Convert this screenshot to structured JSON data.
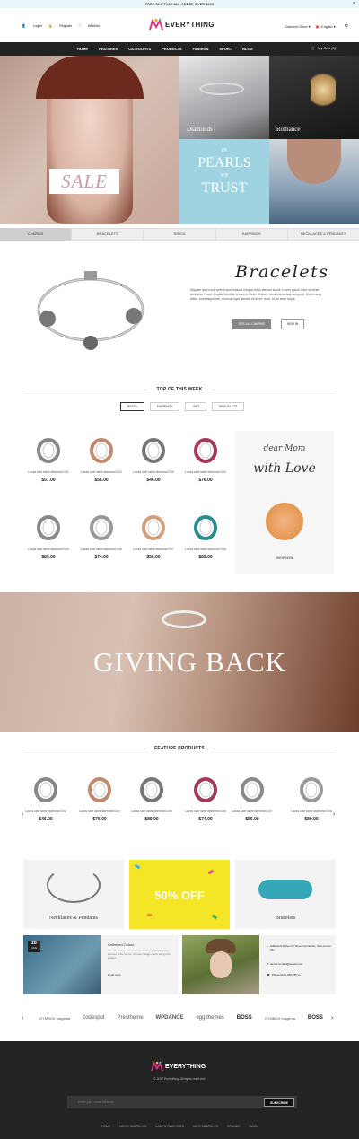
{
  "topbar": {
    "text": "FREE SHIPPING ALL ORDER OVER $399",
    "close": "×"
  },
  "header": {
    "login": "Log In",
    "register": "Register",
    "wishlist": "Wishlist",
    "brand": "EVERYTHING",
    "store": "Diamond Store ▾",
    "language": "English ▾"
  },
  "nav": {
    "items": [
      "HOME",
      "FEATURES",
      "CATEGORYS",
      "PRODUCTS",
      "FASHION",
      "SPORT",
      "BLOG"
    ],
    "cart": "My Cart (0)"
  },
  "hero": {
    "sale": "SALE",
    "diamonds": "Diamonds",
    "romance": "Romance",
    "pearls_line1": "IN",
    "pearls_line2": "PEARLS",
    "pearls_line3": "WE",
    "pearls_line4": "TRUST"
  },
  "tabs": [
    "CHARMS",
    "BRACELETS",
    "RINGS",
    "EARRINGS",
    "NECKLACES & PENDANTS"
  ],
  "feature": {
    "title": "Bracelets",
    "text": "Aliquam quis risus viverra sum masuat congue tellus tibulum suscit. Lorem ipsum dolor sit amet arcu tetur Fusce fringilla Sucibus hendrerit. Dolor sit amet, consectetur adipiscing elit. Donec arcu tellus, scelerisque nec, rhoncus eget, laoreet sit amet, nunc. Ut sit amet turpis.",
    "btn1": "SEE ALL CHARMS",
    "btn2": "NEW IN"
  },
  "top_week": {
    "title": "TOP OF THIS WEEK",
    "filters": [
      "RINGS",
      "EARRINGS",
      "GIFT",
      "BRACELETS"
    ],
    "products": [
      {
        "name": "Lacks side table diamond D01",
        "price": "$57.00"
      },
      {
        "name": "Lacks side table diamond D02",
        "price": "$58.00"
      },
      {
        "name": "Lacks side table diamond D03",
        "price": "$46.00"
      },
      {
        "name": "Lacks side table diamond D04",
        "price": "$76.00"
      },
      {
        "name": "Lacks side table diamond D05",
        "price": "$89.00"
      },
      {
        "name": "Lacks side table diamond D06",
        "price": "$74.00"
      },
      {
        "name": "Lacks side table diamond D07",
        "price": "$56.00"
      },
      {
        "name": "Lacks side table diamond D08",
        "price": "$89.00"
      }
    ],
    "promo": {
      "line1": "dear Mom",
      "line2": "with Love",
      "btn": "SHOP NOW"
    }
  },
  "banner": {
    "text": "GIVING BACK"
  },
  "featured": {
    "title": "FEATURE PRODUCTS",
    "products": [
      {
        "name": "Lacks side table diamond D02",
        "price": "$46.00"
      },
      {
        "name": "Lacks side table diamond D04",
        "price": "$76.00"
      },
      {
        "name": "Lacks side table diamond D05",
        "price": "$89.00"
      },
      {
        "name": "Lacks side table diamond D06",
        "price": "$74.00"
      },
      {
        "name": "Lacks side table diamond D07",
        "price": "$56.00"
      },
      {
        "name": "Lacks side table diamond D08",
        "price": "$89.00"
      }
    ]
  },
  "promos": {
    "necklaces": "Necklaces & Pendants",
    "off": "50% OFF",
    "bracelets": "Bracelets"
  },
  "blog": {
    "day": "28",
    "month": "AUG",
    "title": "Unlimited Colors",
    "text": "You can change the visual appearance of almost every element of the theme. You can change colors using color pickers...",
    "read": "Read more"
  },
  "contact": {
    "address": "Address:012 Son Dr Street Conrender, Nam Amore City",
    "email": "Email:contact@amoid.com",
    "phone": "Phone:0123-456-789 xx"
  },
  "brands": [
    "GYMBOX magenta",
    "codespot",
    "Prestheme",
    "WPDANCE",
    "egg.themes",
    "BOSS",
    "GYMBOX magenta",
    "BOSS"
  ],
  "footer": {
    "brand": "EVERYTHING",
    "copyright": "© 2017 Everything. All rights reserved.",
    "email_placeholder": "Enter your email address",
    "subscribe": "SUBSCRIBE",
    "links": [
      "HOME",
      "MEN'S SWATCHES",
      "LADY'S SWATCHES",
      "KID'S SWATCHES",
      "BRANDS",
      "BLOG"
    ]
  }
}
